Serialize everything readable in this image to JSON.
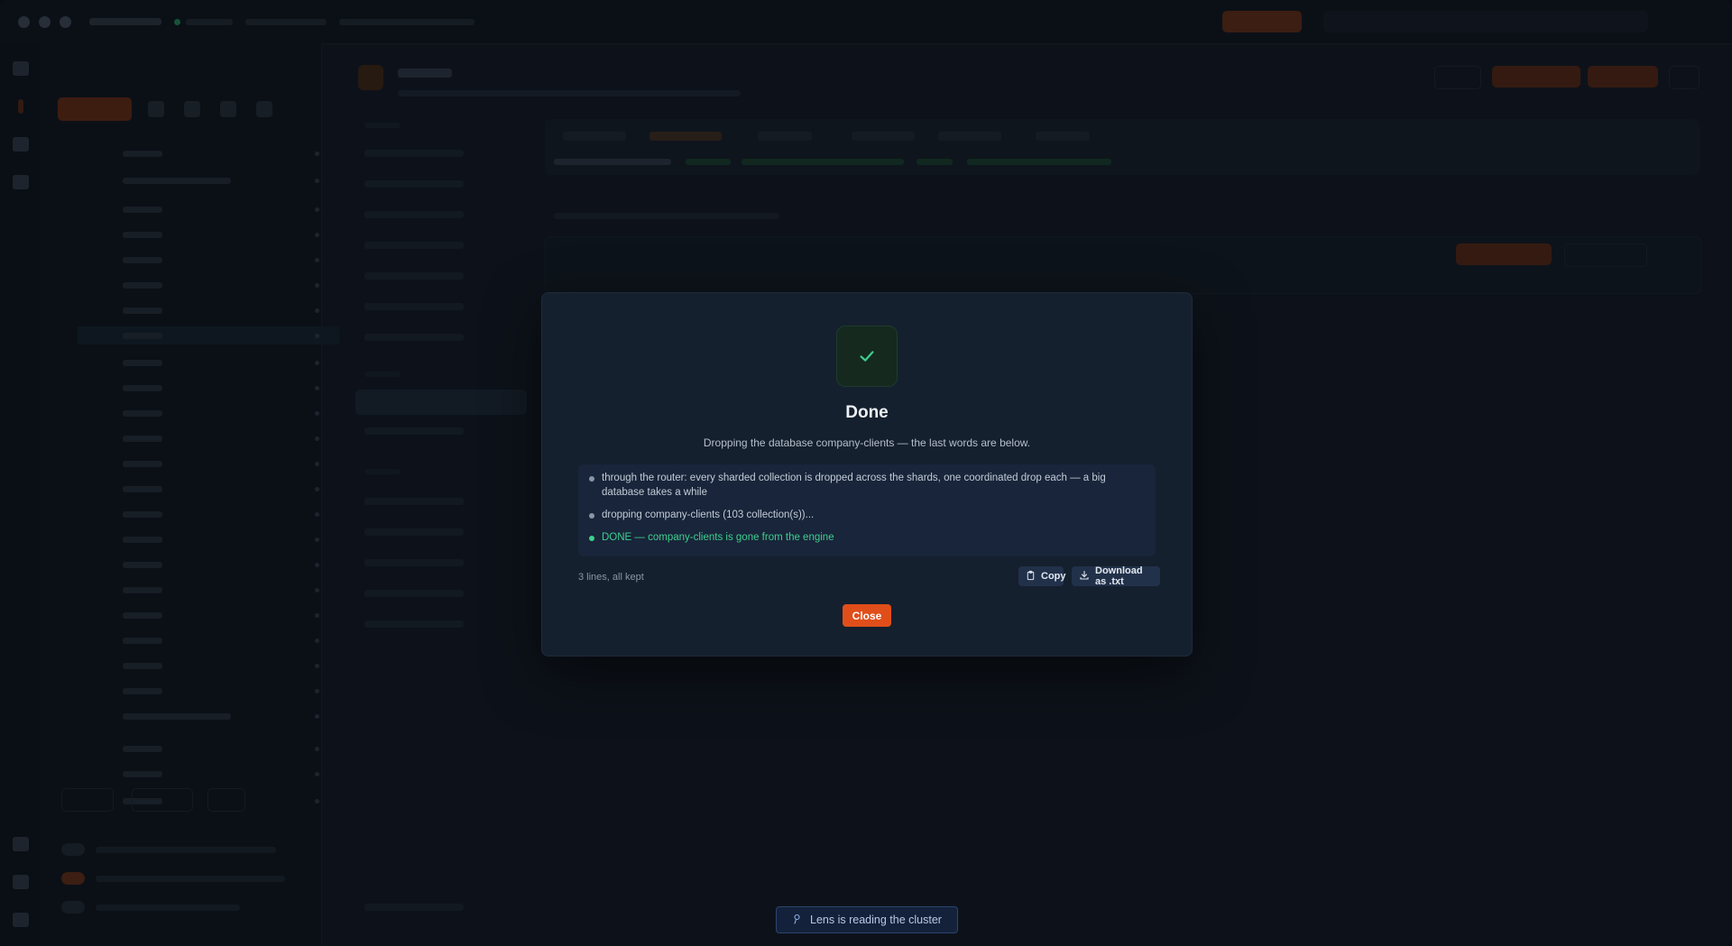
{
  "modal": {
    "title": "Done",
    "subtitle": "Dropping the database company-clients — the last words are below.",
    "log_lines": [
      {
        "text": "through the router: every sharded collection is dropped across the shards, one coordinated drop each — a big database takes a while",
        "status": "info"
      },
      {
        "text": "dropping company-clients (103 collection(s))...",
        "status": "info"
      },
      {
        "text": "DONE — company-clients is gone from the engine",
        "status": "success"
      }
    ],
    "log_count": "3 lines, all kept",
    "copy_label": "Copy",
    "download_label": "Download as .txt",
    "close_label": "Close",
    "icons": {
      "badge": "check-icon",
      "copy": "clipboard-icon",
      "download": "download-icon"
    }
  },
  "status_bar": {
    "text": "Lens is reading the cluster",
    "icon": "lens-icon"
  },
  "colors": {
    "accent": "#e04e1a",
    "success": "#3ecf8e",
    "modal_bg": "#15202e",
    "log_bg": "#18253a"
  }
}
